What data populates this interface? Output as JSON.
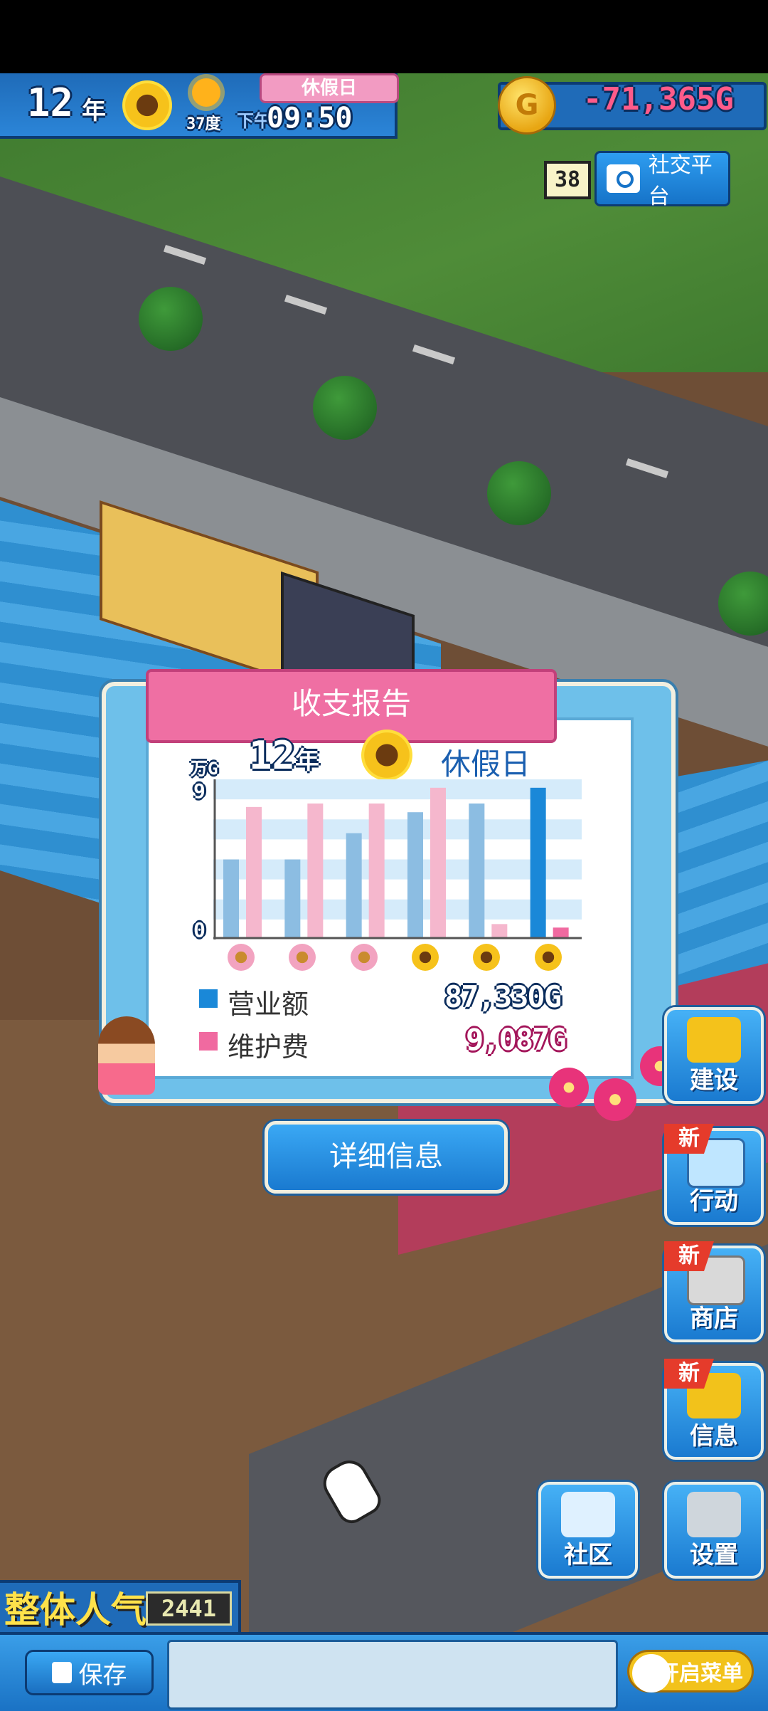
{
  "hud": {
    "year": "12",
    "year_unit": "年",
    "temperature": "37度",
    "holiday": "休假日",
    "ampm": "下午",
    "time": "09:50",
    "money": "-71,365G"
  },
  "social": {
    "badge": "38",
    "button_label": "社交平台"
  },
  "report": {
    "title": "收支报告",
    "year": "12",
    "year_unit": "年",
    "day_type": "休假日",
    "y_unit": "万G",
    "y_max": "9",
    "y_min": "0",
    "legend": [
      {
        "label": "营业额",
        "value": "87,330G",
        "color": "#1a88d8"
      },
      {
        "label": "维护费",
        "value": "9,087G",
        "color": "#f06aa0"
      }
    ],
    "detail_button": "详细信息"
  },
  "chart_data": {
    "type": "bar",
    "categories": [
      "flower",
      "flower",
      "flower",
      "sunflower",
      "sunflower",
      "sunflower"
    ],
    "series": [
      {
        "name": "营业额",
        "values": [
          4.5,
          4.5,
          6.0,
          7.2,
          7.7,
          8.6
        ]
      },
      {
        "name": "维护费",
        "values": [
          7.5,
          7.7,
          7.7,
          8.6,
          0.8,
          0.6
        ]
      }
    ],
    "ylim": [
      0,
      9
    ],
    "y_tick_labels": [
      "0",
      "9"
    ],
    "grid": true
  },
  "side_menu": [
    {
      "label": "建设",
      "new": false,
      "icon": "excavator-icon"
    },
    {
      "label": "行动",
      "new": true,
      "icon": "laptop-icon"
    },
    {
      "label": "商店",
      "new": true,
      "icon": "shopping-cart-icon"
    },
    {
      "label": "信息",
      "new": true,
      "icon": "bar-chart-icon"
    }
  ],
  "new_tag": "新",
  "bottom_buttons": {
    "community": "社区",
    "settings": "设置"
  },
  "popularity": {
    "label": "整体人气",
    "value": "2441"
  },
  "footer": {
    "save": "保存",
    "menu_toggle": "开启菜单"
  }
}
